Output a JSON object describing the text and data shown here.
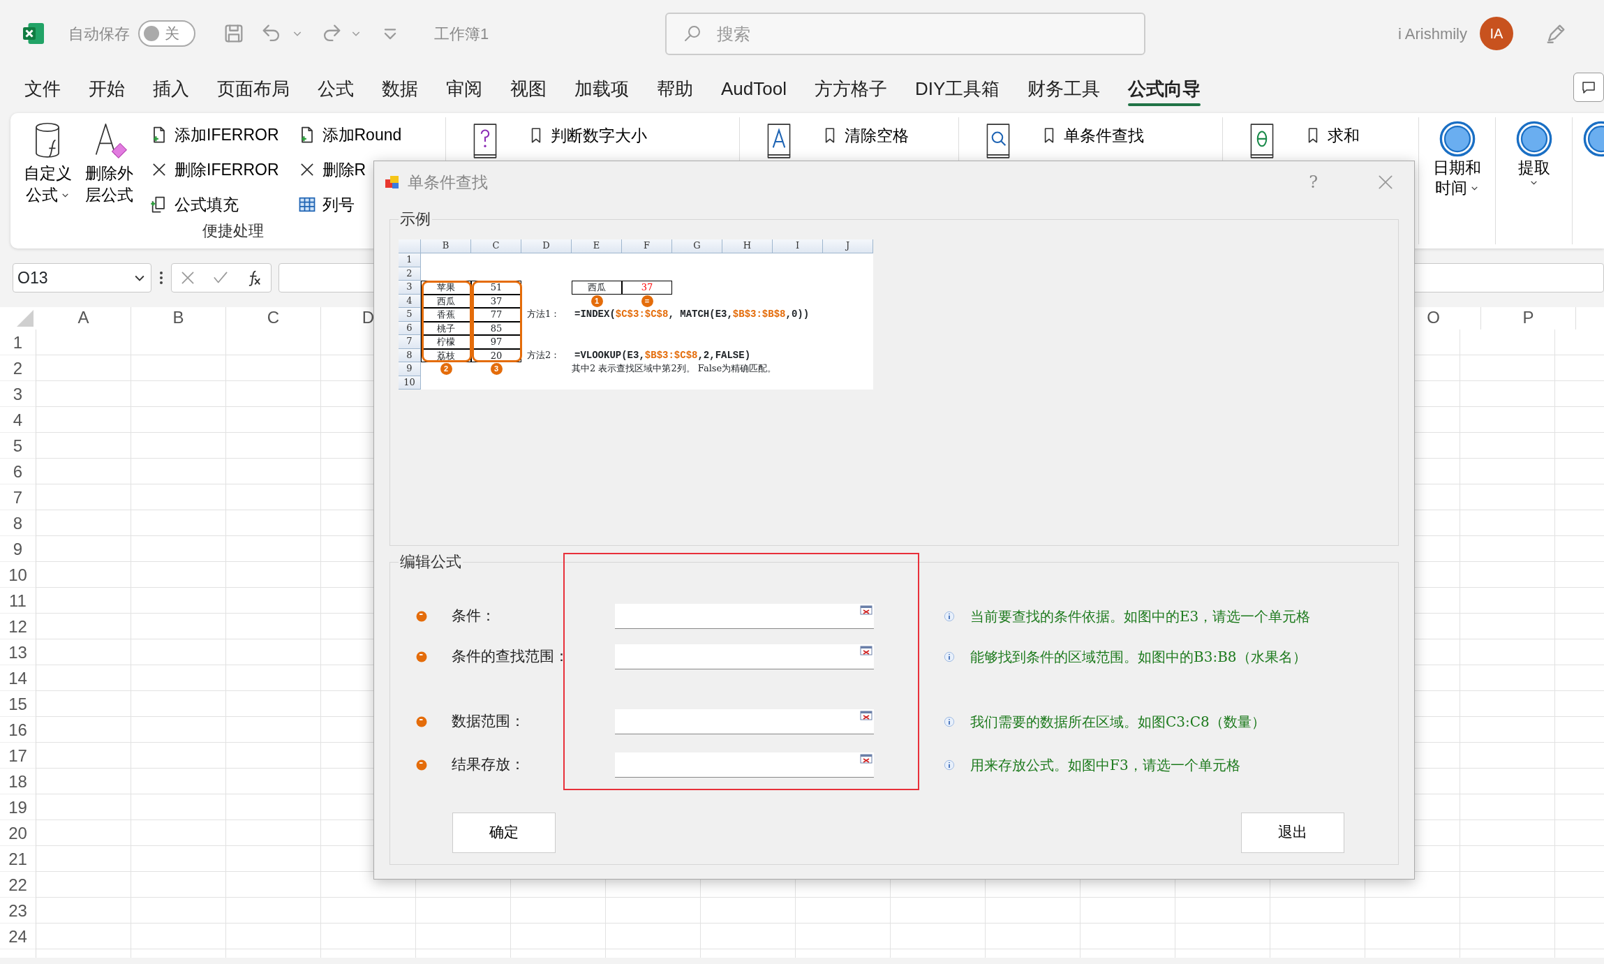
{
  "title_bar": {
    "autosave_label": "自动保存",
    "autosave": {
      "on": false,
      "label": "关"
    },
    "workbook": "工作簿1",
    "search": {
      "placeholder": "搜索"
    },
    "user": "i Arishmily",
    "avatar": "IA"
  },
  "tabs": [
    {
      "label": "文件",
      "selected": false
    },
    {
      "label": "开始",
      "selected": false
    },
    {
      "label": "插入",
      "selected": false
    },
    {
      "label": "页面布局",
      "selected": false
    },
    {
      "label": "公式",
      "selected": false
    },
    {
      "label": "数据",
      "selected": false
    },
    {
      "label": "审阅",
      "selected": false
    },
    {
      "label": "视图",
      "selected": false
    },
    {
      "label": "加载项",
      "selected": false
    },
    {
      "label": "帮助",
      "selected": false
    },
    {
      "label": "AudTool",
      "selected": false
    },
    {
      "label": "方方格子",
      "selected": false
    },
    {
      "label": "DIY工具箱",
      "selected": false
    },
    {
      "label": "财务工具",
      "selected": false
    },
    {
      "label": "公式向导",
      "selected": true
    }
  ],
  "ribbon": {
    "large_buttons": [
      {
        "lines": [
          "自定义",
          "公式"
        ],
        "menu": true
      },
      {
        "lines": [
          "删除外",
          "层公式"
        ],
        "menu": false
      }
    ],
    "small_columns": [
      [
        "添加IFERROR",
        "删除IFERROR",
        "公式填充"
      ],
      [
        "添加Round",
        "删除R",
        "列号"
      ]
    ],
    "group_label": "便捷处理",
    "tools": [
      "判断数字大小",
      "清除空格",
      "单条件查找",
      "求和"
    ],
    "round_buttons": [
      {
        "lines": [
          "日期和",
          "时间"
        ],
        "menu": true
      },
      {
        "lines": [
          "提取"
        ],
        "menu": true
      }
    ]
  },
  "formula_bar": {
    "name_box": "O13"
  },
  "sheet": {
    "columns_left": [
      "A",
      "B",
      "C",
      "D"
    ],
    "columns_right": [
      "O",
      "P"
    ],
    "rows": [
      "1",
      "2",
      "3",
      "4",
      "5",
      "6",
      "7",
      "8",
      "9",
      "10",
      "11",
      "12",
      "13",
      "14",
      "15",
      "16",
      "17",
      "18",
      "19",
      "20",
      "21",
      "22",
      "23",
      "24"
    ]
  },
  "dialog": {
    "title": "单条件查找",
    "help": "?",
    "example": {
      "legend": "示例",
      "columns": [
        "B",
        "C",
        "D",
        "E",
        "F",
        "G",
        "H",
        "I",
        "J"
      ],
      "rows": [
        "1",
        "2",
        "3",
        "4",
        "5",
        "6",
        "7",
        "8",
        "9",
        "10"
      ],
      "fruits": [
        {
          "name": "苹果",
          "count": "51"
        },
        {
          "name": "西瓜",
          "count": "37"
        },
        {
          "name": "香蕉",
          "count": "77"
        },
        {
          "name": "桃子",
          "count": "85"
        },
        {
          "name": "柠檬",
          "count": "97"
        },
        {
          "name": "荔枝",
          "count": "20"
        }
      ],
      "lookup": {
        "key": "西瓜",
        "result": "37"
      },
      "badges": [
        "1",
        "=",
        "2",
        "3"
      ],
      "methods": [
        {
          "label": "方法1：",
          "formula": [
            {
              "text": "=INDEX(",
              "highlight": false
            },
            {
              "text": "$C$3:$C$8",
              "highlight": true
            },
            {
              "text": ", MATCH(E3,",
              "highlight": false
            },
            {
              "text": "$B$3:$B$8",
              "highlight": true
            },
            {
              "text": ",0))",
              "highlight": false
            }
          ]
        },
        {
          "label": "方法2：",
          "formula": [
            {
              "text": "=VLOOKUP(E3,",
              "highlight": false
            },
            {
              "text": "$B$3:$C$8",
              "highlight": true
            },
            {
              "text": ",2,FALSE)",
              "highlight": false
            }
          ]
        }
      ],
      "note": "其中2 表示查找区域中第2列。 False为精确匹配。"
    },
    "edit": {
      "legend": "编辑公式",
      "fields": [
        {
          "label": "条件：",
          "hint": "当前要查找的条件依据。如图中的E3，请选一个单元格"
        },
        {
          "label": "条件的查找范围：",
          "hint": "能够找到条件的区域范围。如图中的B3:B8（水果名）"
        },
        {
          "label": "数据范围：",
          "hint": "我们需要的数据所在区域。如图C3:C8（数量）"
        },
        {
          "label": "结果存放：",
          "hint": "用来存放公式。如图中F3，请选一个单元格"
        }
      ]
    },
    "buttons": [
      "确定",
      "退出"
    ]
  }
}
